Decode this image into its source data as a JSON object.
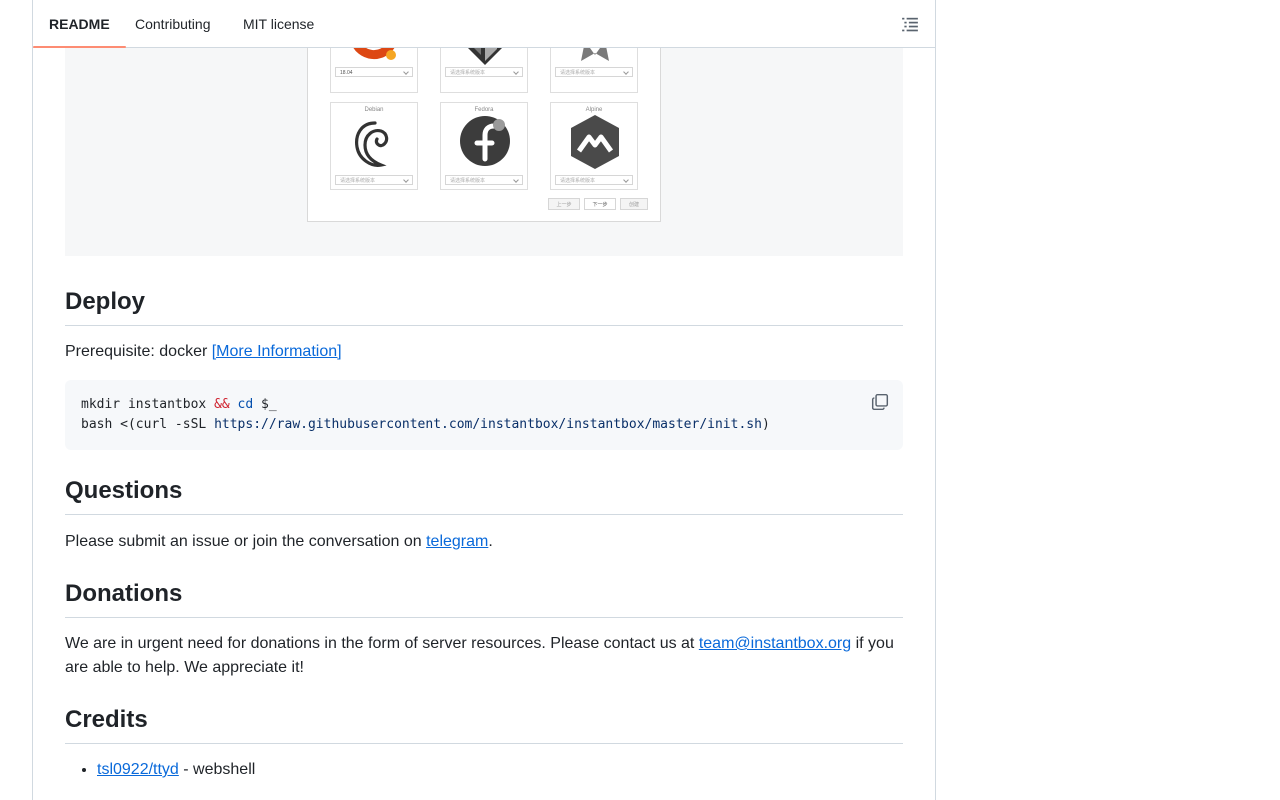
{
  "tabs": [
    {
      "label": "README",
      "active": true
    },
    {
      "label": "Contributing",
      "active": false
    },
    {
      "label": "MIT license",
      "active": false
    }
  ],
  "screenshot": {
    "top_row": [
      {
        "version": "18.04"
      },
      {
        "version": "请选择系统版本"
      },
      {
        "version": "请选择系统版本"
      }
    ],
    "bottom_row": [
      {
        "name": "Debian",
        "version": "请选择系统版本"
      },
      {
        "name": "Fedora",
        "version": "请选择系统版本"
      },
      {
        "name": "Alpine",
        "version": "请选择系统版本"
      }
    ],
    "buttons": [
      "上一步",
      "下一步",
      "创建"
    ]
  },
  "deploy": {
    "heading": "Deploy",
    "prereq_text": "Prerequisite: docker ",
    "prereq_link": "[More Information]",
    "code": {
      "l1_a": "mkdir instantbox ",
      "l1_op": "&&",
      "l1_sp": " ",
      "l1_cd": "cd",
      "l1_b": " $_",
      "l2_a": "bash <(curl -sSL ",
      "l2_url": "https://raw.githubusercontent.com/instantbox/instantbox/master/init.sh",
      "l2_b": ")"
    }
  },
  "questions": {
    "heading": "Questions",
    "text": "Please submit an issue or join the conversation on ",
    "link": "telegram",
    "end": "."
  },
  "donations": {
    "heading": "Donations",
    "text": "We are in urgent need for donations in the form of server resources. Please contact us at ",
    "link": "team@instantbox.org",
    "end": " if you are able to help. We appreciate it!"
  },
  "credits": {
    "heading": "Credits",
    "items": [
      {
        "link": "tsl0922/ttyd",
        "desc": " - webshell"
      }
    ]
  },
  "colors": {
    "link": "#0969da",
    "active_tab_underline": "#fd8c73",
    "code_bg": "#f6f8fa"
  }
}
